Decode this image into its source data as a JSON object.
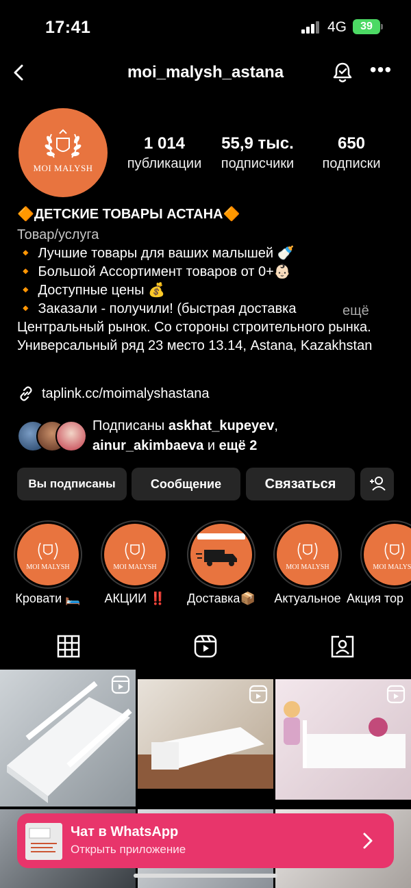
{
  "status_bar": {
    "time": "17:41",
    "network": "4G",
    "battery": "39"
  },
  "header": {
    "username": "moi_malysh_astana"
  },
  "profile": {
    "avatar_text": "MOI MALYSH",
    "stats": [
      {
        "value": "1 014",
        "label": "публикации"
      },
      {
        "value": "55,9 тыс.",
        "label": "подписчики"
      },
      {
        "value": "650",
        "label": "подписки"
      }
    ],
    "name": "🔶ДЕТСКИЕ ТОВАРЫ АСТАНА🔶",
    "category": "Товар/услуга",
    "bio_lines": [
      "🔸 Лучшие товары для ваших малышей 🍼",
      "🔸 Большой Ассортимент товаров от 0+👶🏻",
      "🔸 Доступные цены 💰",
      "🔸 Заказали - получили! (быстрая доставка"
    ],
    "more_label": "ещё",
    "address": "Центральный рынок. Со стороны строительного рынка. Универсальный ряд 23 место 13.14, Astana, Kazakhstan",
    "link": "taplink.cc/moimalyshastana"
  },
  "followed_by": {
    "prefix": "Подписаны ",
    "user1": "askhat_kupeyev",
    "comma": ",",
    "user2": "ainur_akimbaeva",
    "middle": " и ",
    "suffix": "ещё 2"
  },
  "buttons": {
    "following": "Вы подписаны",
    "message": "Сообщение",
    "contact": "Связаться"
  },
  "highlights": [
    {
      "label": "Кровати 🛏️",
      "logo": "MOI MALYSH"
    },
    {
      "label": "АКЦИИ ‼️",
      "logo": "MOI MALYSH"
    },
    {
      "label": "Доставка📦",
      "logo": ""
    },
    {
      "label": "Актуальное",
      "logo": "MOI MALYSH"
    },
    {
      "label": "Акция тор",
      "logo": "MOI MALYSH"
    }
  ],
  "banner": {
    "title": "Чат в WhatsApp",
    "subtitle": "Открыть приложение"
  },
  "colors": {
    "brand_orange": "#e8743f",
    "banner_pink": "#e8356b",
    "button_bg": "#262626",
    "battery_green": "#4cd964"
  }
}
